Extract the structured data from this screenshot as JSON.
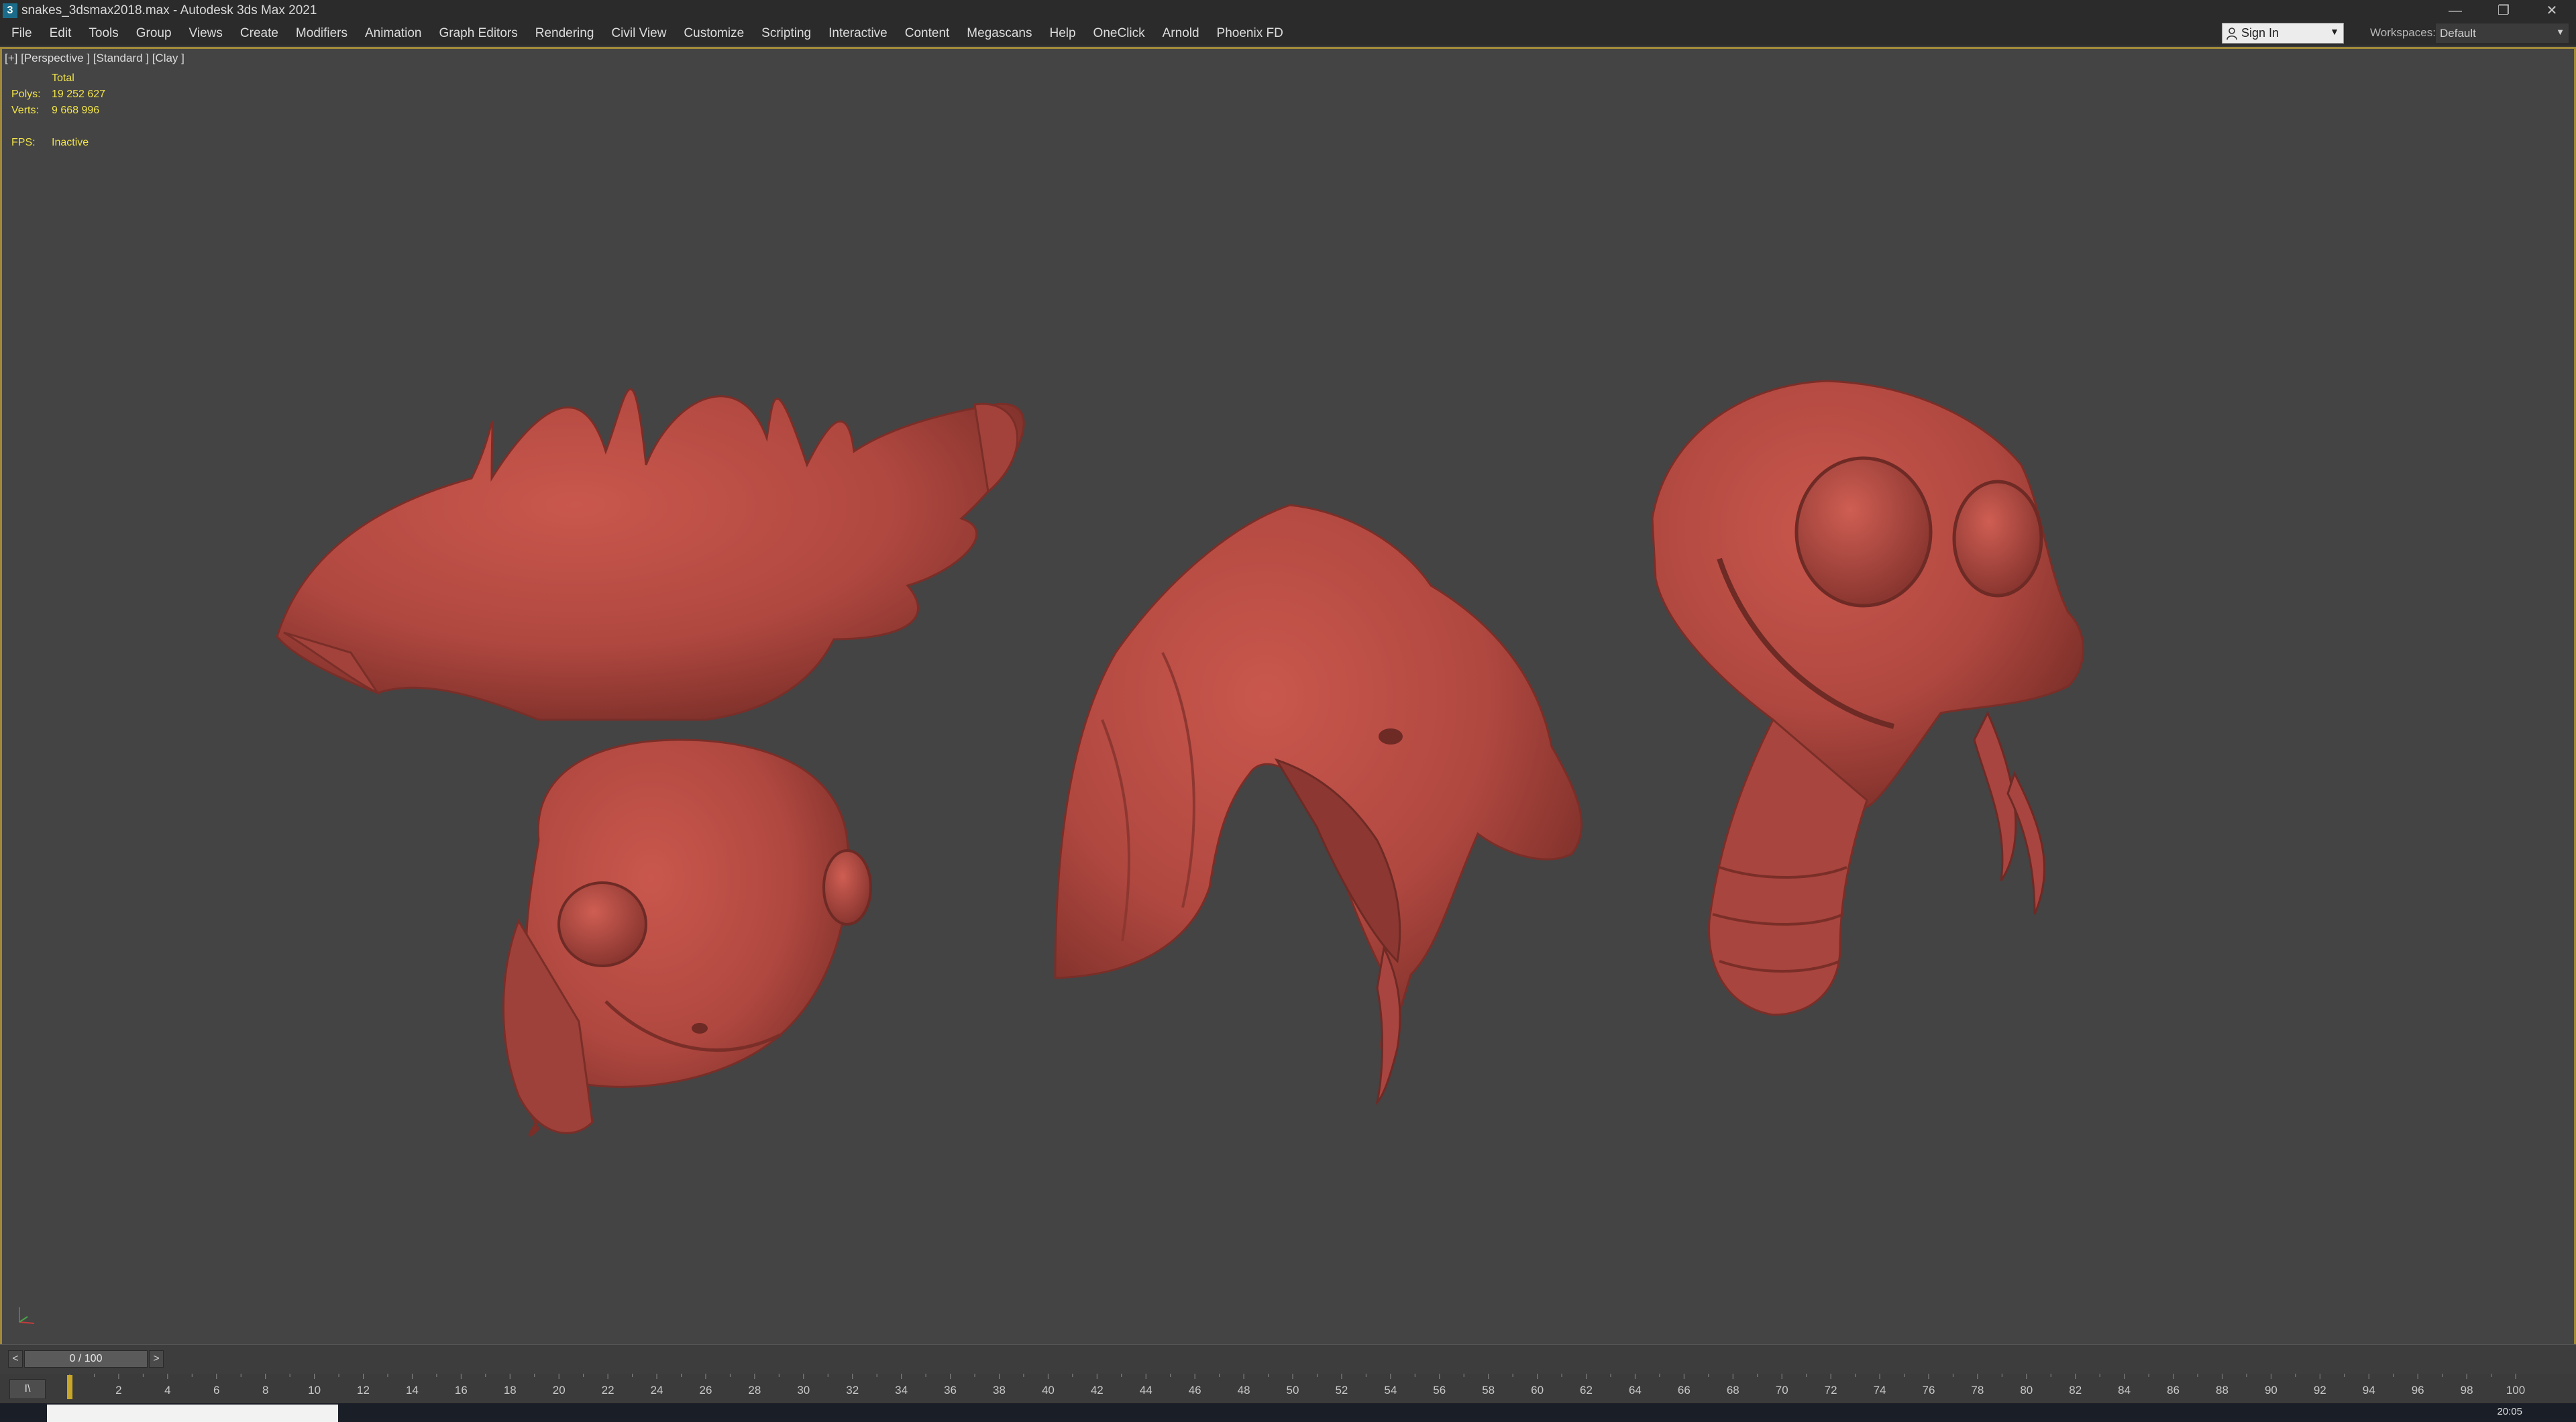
{
  "window": {
    "title": "snakes_3dsmax2018.max - Autodesk 3ds Max 2021",
    "app_icon": "3",
    "controls": {
      "minimize": "—",
      "restore": "❐",
      "close": "✕"
    }
  },
  "menubar": {
    "items": [
      "File",
      "Edit",
      "Tools",
      "Group",
      "Views",
      "Create",
      "Modifiers",
      "Animation",
      "Graph Editors",
      "Rendering",
      "Civil View",
      "Customize",
      "Scripting",
      "Interactive",
      "Content",
      "Megascans",
      "Help",
      "OneClick",
      "Arnold",
      "Phoenix FD"
    ],
    "sign_in": {
      "label": "Sign In",
      "arrow": "▼"
    },
    "workspaces": {
      "label": "Workspaces:",
      "value": "Default",
      "arrow": "▼"
    }
  },
  "viewport": {
    "label": "[+] [Perspective ] [Standard ] [Clay ]",
    "stats": {
      "header": "Total",
      "polys_label": "Polys:",
      "polys_value": "19 252 627",
      "verts_label": "Verts:",
      "verts_value": "9 668 996",
      "fps_label": "FPS:",
      "fps_value": "Inactive"
    },
    "model_color": "#b54a42",
    "background_color": "#444444"
  },
  "timeslider": {
    "frame_label": "0 / 100",
    "prev": "<",
    "next": ">"
  },
  "trackbar": {
    "icon_label": "I\\",
    "tick_labels": [
      "2",
      "4",
      "6",
      "8",
      "10",
      "12",
      "14",
      "16",
      "18",
      "20",
      "22",
      "24",
      "26",
      "28",
      "30",
      "32",
      "34",
      "36",
      "38",
      "40",
      "42",
      "44",
      "46",
      "48",
      "50",
      "52",
      "54",
      "56",
      "58",
      "60",
      "62",
      "64",
      "66",
      "68",
      "70",
      "72",
      "74",
      "76",
      "78",
      "80",
      "82",
      "84",
      "86",
      "88",
      "90",
      "92",
      "94",
      "96",
      "98",
      "100"
    ]
  },
  "taskbar": {
    "clock": "20:05"
  }
}
